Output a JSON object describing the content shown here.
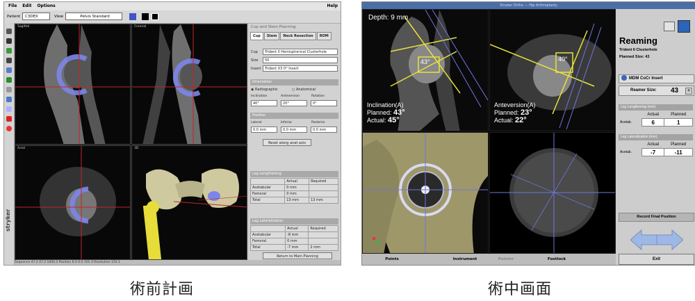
{
  "captions": {
    "left": "術前計画",
    "right": "術中画面"
  },
  "preop": {
    "menu": [
      "File",
      "Edit",
      "Options"
    ],
    "menu_right": "Help",
    "toolbar": {
      "patient_label": "Patient",
      "patient_value": "C3DEX",
      "view_label": "View",
      "view_value": "Pelvis Standard"
    },
    "views": [
      "Sagittal",
      "Coronal",
      "Axial",
      "3D"
    ],
    "brand": "stryker",
    "statusbar": "Sequence   47.2   47.2   1000.2   Position        6.0   0.0   101.3                    Resolution   152.1",
    "panel": {
      "title": "Cup and Stem Planning",
      "tabs": [
        "Cup",
        "Stem",
        "Neck Resection",
        "ROM"
      ],
      "type_label": "Cup",
      "type_value": "Trident II Hemispherical Clusterhole",
      "size_label": "Size",
      "size_value": "50",
      "insert_label": "Insert",
      "insert_value": "Trident X3 0° Insert",
      "orientation_header": "Orientation",
      "radiographic": "Radiographic",
      "anatomical": "Anatomical",
      "orientation_cols": [
        "Inclination",
        "Anteversion",
        "Rotation"
      ],
      "orientation_vals": [
        "40°",
        "20°",
        "0°"
      ],
      "position_header": "Position",
      "position_cols": [
        "Lateral",
        "Inferior",
        "Posterior"
      ],
      "position_vals": [
        "0.0 mm",
        "0.0 mm",
        "0.0 mm"
      ],
      "reset_button": "Reset along anat axis",
      "leg_length_header": "Leg Lengthening",
      "leg_length_table": {
        "cols": [
          "",
          "Actual",
          "Required"
        ],
        "rows": [
          [
            "Acetabular",
            "0 mm",
            ""
          ],
          [
            "Femoral",
            "0 mm",
            ""
          ],
          [
            "Total",
            "13 mm",
            "13 mm"
          ]
        ]
      },
      "lateral_header": "Leg Lateralization",
      "lateral_table": {
        "cols": [
          "",
          "Actual",
          "Required"
        ],
        "rows": [
          [
            "Acetabular",
            "-8 mm",
            ""
          ],
          [
            "Femoral",
            "0 mm",
            ""
          ],
          [
            "Total",
            "-7 mm",
            "2 mm"
          ]
        ]
      },
      "return_button": "Return to Main Planning"
    }
  },
  "intraop": {
    "title": "Stryker Ortho — Hip Arthroplasty",
    "depth_label": "Depth:",
    "depth_value": "9 mm",
    "angle1": "43°",
    "angle2": "40°",
    "inclination": {
      "heading": "Inclination(A)",
      "planned_label": "Planned:",
      "planned_value": "43°",
      "actual_label": "Actual:",
      "actual_value": "45°"
    },
    "anteversion": {
      "heading": "Anteversion(A)",
      "planned_label": "Planned:",
      "planned_value": "23°",
      "actual_label": "Actual:",
      "actual_value": "22°"
    },
    "bottom_buttons": [
      "Points",
      "Instrument",
      "Pointer",
      "Footlock"
    ],
    "side": {
      "title": "Reaming",
      "subtitle1": "Trident II Clusterhole",
      "subtitle2": "Planned Size: 43",
      "insert": "MDM CoCr Insert",
      "reamer_label": "Reamer Size:",
      "reamer_value": "43",
      "leg_length_header": "Leg Lengthening (mm)",
      "leg_length": {
        "cols": [
          "",
          "Actual",
          "Planned"
        ],
        "row_label": "Acetab.",
        "actual": "6",
        "planned": "1"
      },
      "lateral_header": "Leg Lateralization (mm)",
      "lateral": {
        "cols": [
          "",
          "Actual",
          "Planned"
        ],
        "row_label": "Acetab.",
        "actual": "-7",
        "planned": "-11"
      },
      "record_button": "Record Final Position",
      "exit_button": "Exit"
    }
  },
  "colors": {
    "implant_blue": "#7c85e8",
    "crosshair_red": "#c0262a",
    "yellow_line": "#e8e23a",
    "bone_yellow": "#d8d08a",
    "nav_arrow": "#9db8e6"
  }
}
